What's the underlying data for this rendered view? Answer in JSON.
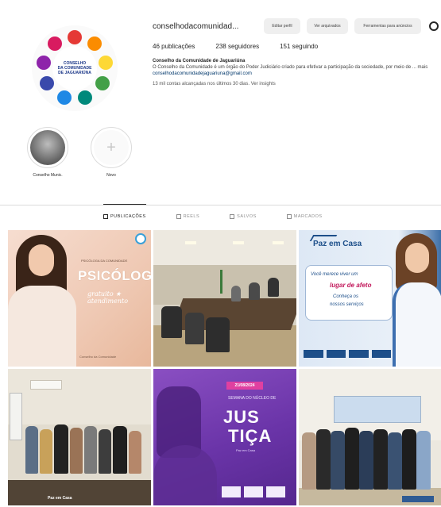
{
  "profile": {
    "username": "conselhodacomunidad...",
    "buttons": [
      "Editar perfil",
      "Ver arquivados",
      "Ferramentas para anúncios"
    ],
    "stats": [
      "46 publicações",
      "238 seguidores",
      "151 seguindo"
    ],
    "bio_name": "Conselho da Comunidade de Jaguariúna",
    "bio_text": "O Conselho da Comunidade é um órgão do Poder Judiciário criado para efetivar a participação da sociedade, por meio de ... mais",
    "bio_link": "conselhodacomunidadejaguariuna@gmail.com",
    "followed_by": "13 mil contas alcançadas nos últimos 30 dias. Ver insights",
    "avatar_text": [
      "CONSELHO",
      "DA COMUNIDADE",
      "DE JAGUARIÚNA"
    ]
  },
  "highlights": [
    {
      "label": "Conselho Munic."
    },
    {
      "label": "Novo"
    }
  ],
  "tabs": [
    "PUBLICAÇÕES",
    "REELS",
    "SALVOS",
    "MARCADOS"
  ],
  "posts": {
    "p1": {
      "small": "PSICÓLOGA DA COMUNIDADE",
      "title": "PSICÓLOGO",
      "script": "gratuito ★ atendimento",
      "footer": "Conselho da Comunidade"
    },
    "p3": {
      "brand": "Paz em Casa",
      "line1": "Você merece viver um",
      "line2": "lugar de afeto",
      "line3": "Conheça os",
      "line4": "nossos serviços"
    },
    "p4": {
      "tag": "Paz em Casa"
    },
    "p5": {
      "date": "21/08/2024",
      "sub": "SEMANA DO NÚCLEO DE",
      "title1": "JUS",
      "title2": "TIÇA",
      "line": "Paz em Casa"
    }
  },
  "colors": {
    "link": "#00376b",
    "accent_purple": "#6a34a8",
    "accent_blue": "#1d4f8a"
  }
}
